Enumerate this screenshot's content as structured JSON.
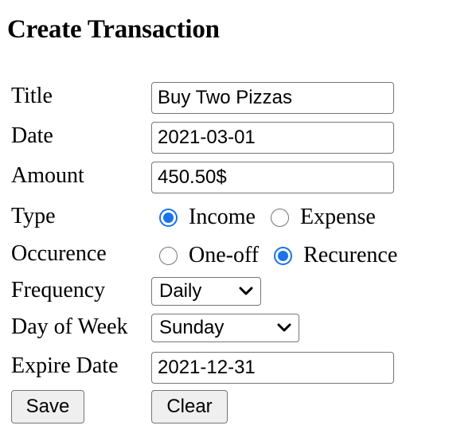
{
  "page": {
    "heading": "Create Transaction"
  },
  "form": {
    "title": {
      "label": "Title",
      "value": "Buy Two Pizzas"
    },
    "date": {
      "label": "Date",
      "value": "2021-03-01"
    },
    "amount": {
      "label": "Amount",
      "value": "450.50$"
    },
    "type": {
      "label": "Type",
      "options": [
        "Income",
        "Expense"
      ],
      "selected": "Income"
    },
    "occurrence": {
      "label": "Occurence",
      "options": [
        "One-off",
        "Recurence"
      ],
      "selected": "Recurence"
    },
    "frequency": {
      "label": "Frequency",
      "value": "Daily"
    },
    "day_of_week": {
      "label": "Day of Week",
      "value": "Sunday"
    },
    "expire_date": {
      "label": "Expire Date",
      "value": "2021-12-31"
    }
  },
  "actions": {
    "save_label": "Save",
    "clear_label": "Clear"
  },
  "colors": {
    "radio_selected": "#1a73e8",
    "input_border": "#767676",
    "button_bg": "#efefef"
  },
  "icons": {
    "select_arrow": "chevron-down-icon"
  }
}
